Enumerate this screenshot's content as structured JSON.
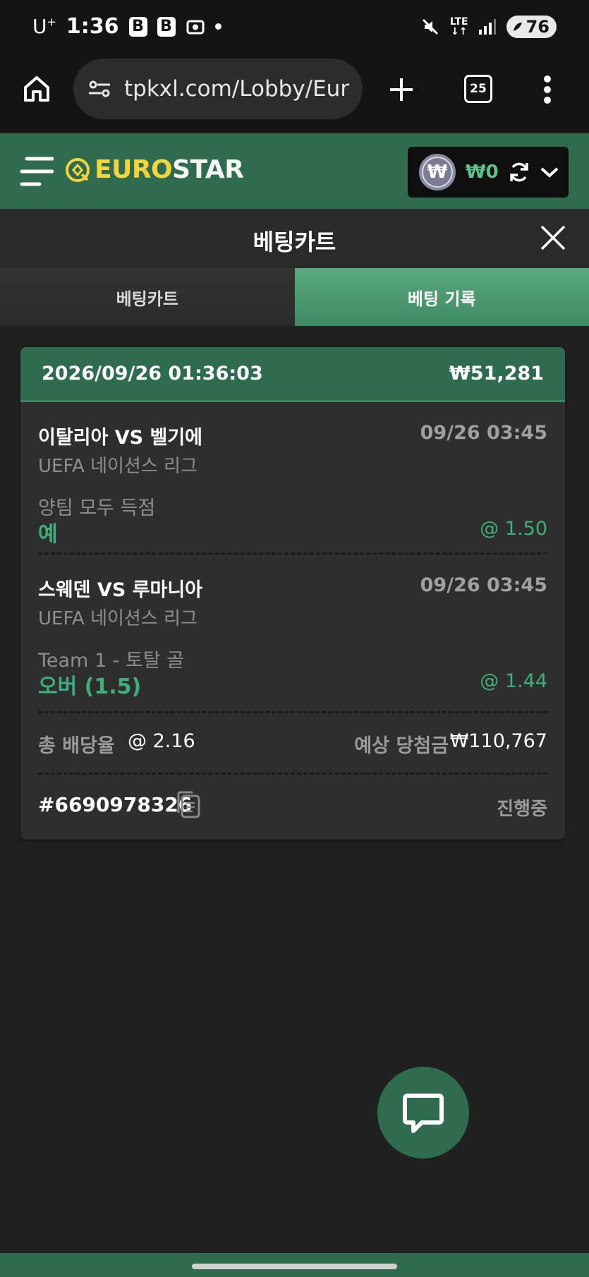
{
  "status_bar": {
    "carrier": "U",
    "carrier_sup": "+",
    "time": "1:36",
    "app_icon_1": "B",
    "app_icon_2": "B",
    "network": "LTE",
    "battery": "76"
  },
  "browser": {
    "url": "tpkxl.com/Lobby/Eur",
    "tab_count": "25"
  },
  "site": {
    "logo_part1": "EURO",
    "logo_part2": "STAR",
    "wallet_currency_symbol": "₩",
    "wallet_amount": "₩0"
  },
  "panel": {
    "title": "베팅카트"
  },
  "tabs": [
    {
      "label": "베팅카트",
      "active": false
    },
    {
      "label": "베팅 기록",
      "active": true
    }
  ],
  "bet_record": {
    "datetime": "2026/09/26 01:36:03",
    "stake": "₩51,281",
    "selections": [
      {
        "match": "이탈리아 VS 벨기에",
        "time": "09/26 03:45",
        "league": "UEFA 네이션스 리그",
        "market": "양팀 모두 득점",
        "pick": "예",
        "odds": "@ 1.50"
      },
      {
        "match": "스웨덴 VS 루마니아",
        "time": "09/26 03:45",
        "league": "UEFA 네이션스 리그",
        "market": "Team 1 - 토탈 골",
        "pick": "오버 (1.5)",
        "odds": "@ 1.44"
      }
    ],
    "total_odds_label": "총 배당율",
    "total_odds": "@ 2.16",
    "payout_label": "예상 당첨금",
    "payout": "₩110,767",
    "ticket_id": "#6690978326",
    "status": "진행중"
  },
  "colors": {
    "brand_green": "#2f6b4f",
    "accent_green": "#3fae7a",
    "logo_yellow": "#f3d43a"
  }
}
